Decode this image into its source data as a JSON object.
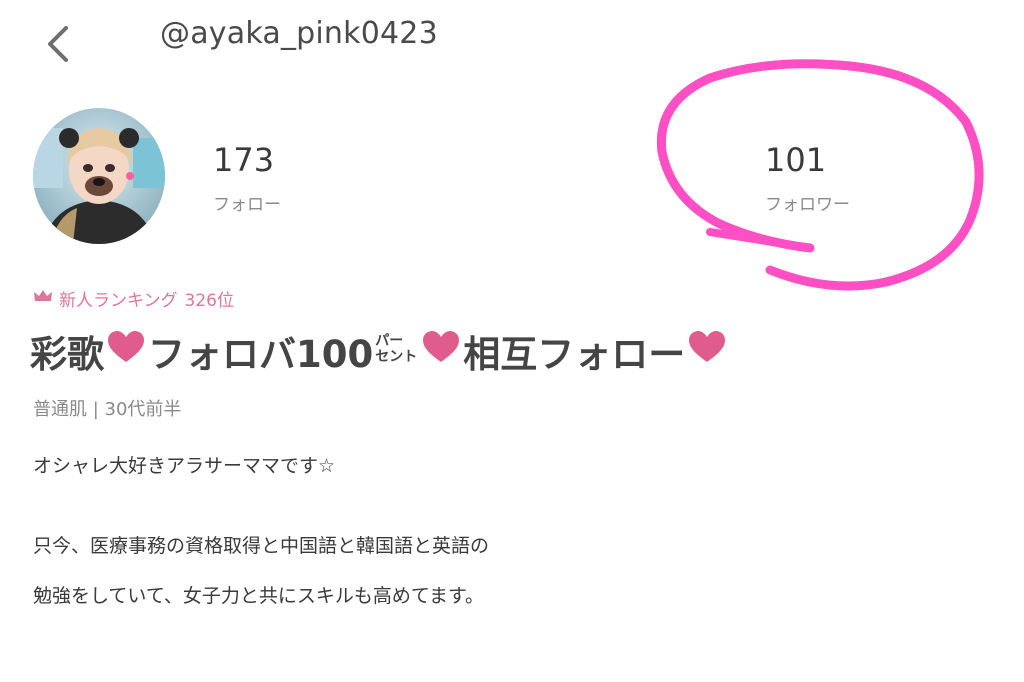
{
  "header": {
    "back_icon": "chevron-left-icon",
    "handle": "@ayaka_pink0423"
  },
  "profile": {
    "avatar_alt": "profile photo",
    "stats": {
      "following": {
        "value": "173",
        "label": "フォロー"
      },
      "followers": {
        "value": "101",
        "label": "フォロワー"
      }
    },
    "annotation_color": "#ff4fc4",
    "ranking": {
      "icon": "crown-icon",
      "label": "新人ランキング",
      "value": "326位",
      "color": "#e0749a"
    },
    "name": {
      "part1": "彩歌",
      "part2": "フォロバ100",
      "stack_top": "パー",
      "stack_bottom": "セント",
      "part3": "相互フォロー",
      "heart_color": "#e05c8d"
    },
    "attributes": "普通肌 | 30代前半",
    "bio": {
      "line1": "オシャレ大好きアラサーママです☆",
      "line2": "只今、医療事務の資格取得と中国語と韓国語と英語の",
      "line3": "勉強をしていて、女子力と共にスキルも高めてます。"
    }
  }
}
